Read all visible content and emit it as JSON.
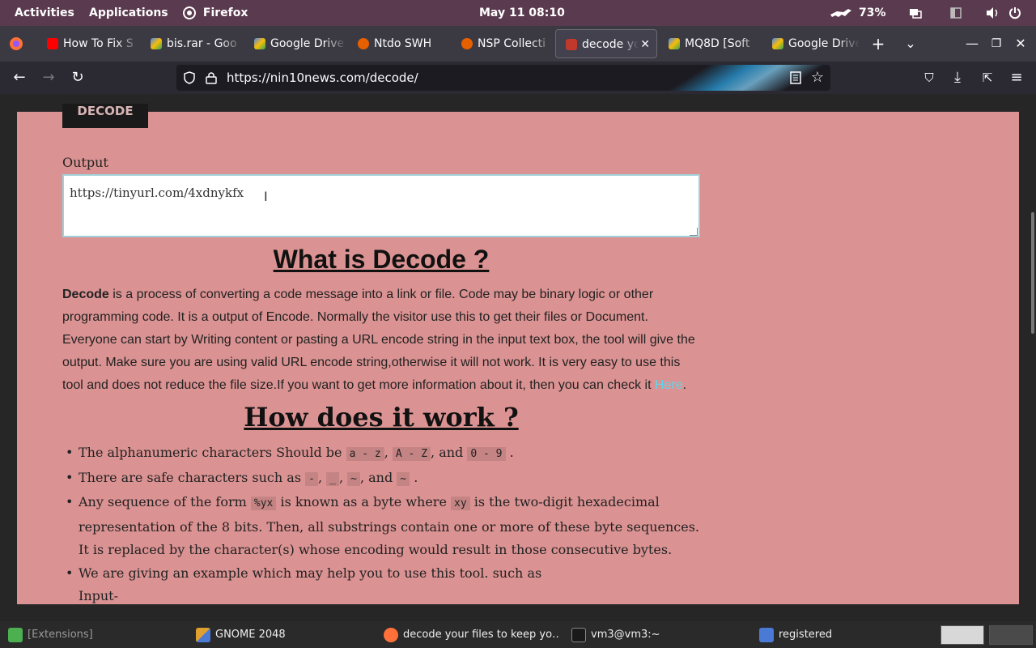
{
  "topbar": {
    "activities": "Activities",
    "applications": "Applications",
    "app_name": "Firefox",
    "datetime": "May 11  08:10",
    "battery": "73%"
  },
  "tabs": [
    {
      "label": "How To Fix S",
      "favicon": "youtube-icon",
      "color": "#ff0000"
    },
    {
      "label": "bis.rar - Goo",
      "favicon": "google-drive-icon",
      "color": "#4285f4"
    },
    {
      "label": "Google Drive",
      "favicon": "google-drive-icon",
      "color": "#34a853"
    },
    {
      "label": "Ntdo SWH",
      "favicon": "firefox-dev-icon",
      "color": "#e66000"
    },
    {
      "label": "NSP Collecti",
      "favicon": "firefox-dev-icon",
      "color": "#e66000"
    },
    {
      "label": "decode your",
      "favicon": "site-icon",
      "color": "#c0392b"
    },
    {
      "label": "MQ8D [Soft",
      "favicon": "google-drive-icon",
      "color": "#4285f4"
    },
    {
      "label": "Google Drive",
      "favicon": "google-drive-icon",
      "color": "#fbbc05"
    }
  ],
  "navbar": {
    "url": "https://nin10news.com/decode/"
  },
  "page": {
    "decode_button": "DECODE",
    "output_label": "Output",
    "output_value": "https://tinyurl.com/4xdnykfx",
    "what_heading": "What is Decode ?",
    "para_bold": "Decode",
    "para_text": " is a process of converting a code message into a link or file. Code may be binary logic or other programming code. It is a output of Encode. Normally the visitor use this to get their files or Document. Everyone can start by Writing content or pasting a URL encode string in the input text box, the tool will give the output. Make sure you are using valid URL encode string,otherwise it will not work. It is very easy to use this tool and does not reduce the file size.If you want to get more information about it, then you can check it ",
    "para_link": "Here",
    "para_end": ".",
    "how_heading": "How does it work ?",
    "bullets": {
      "b1_pre": "The alphanumeric characters Should be ",
      "b1_c1": "a - z",
      "b1_sep1": ", ",
      "b1_c2": "A - Z",
      "b1_sep2": ", and ",
      "b1_c3": "0 - 9",
      "b1_end": " .",
      "b2_pre": "There are safe characters such as ",
      "b2_c1": "-",
      "b2_sep1": ", ",
      "b2_c2": "_",
      "b2_sep2": ", ",
      "b2_c3": "~",
      "b2_sep3": ", and ",
      "b2_c4": "~",
      "b2_end": " .",
      "b3_pre": "Any sequence of the form ",
      "b3_c1": "%yx",
      "b3_mid": " is known as a byte where ",
      "b3_c2": "xy",
      "b3_end": " is the two-digit hexadecimal representation of the 8 bits. Then, all substrings contain one or more of these byte sequences. It is replaced by the character(s) whose encoding would result in those consecutive bytes.",
      "b4_text": "We are giving an example which may help you to use this tool. such as",
      "b4_sub": "Input-"
    }
  },
  "taskbar": [
    {
      "label": "[Extensions]",
      "icon": "puzzle-icon",
      "color": "#4caf50"
    },
    {
      "label": "GNOME 2048",
      "icon": "game-icon",
      "color": "#e0a030"
    },
    {
      "label": "decode your files to keep yo…",
      "icon": "firefox-icon",
      "color": "#ff7139"
    },
    {
      "label": "vm3@vm3:~",
      "icon": "terminal-icon",
      "color": "#444"
    },
    {
      "label": "registered",
      "icon": "document-icon",
      "color": "#4a7ad6"
    }
  ]
}
